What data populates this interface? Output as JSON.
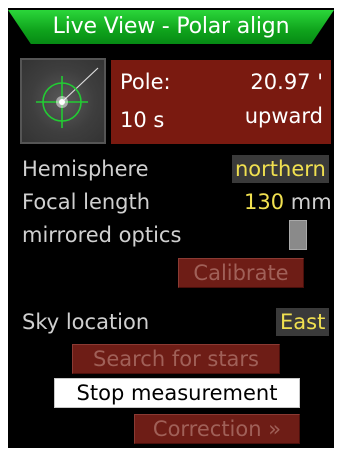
{
  "title": "Live View - Polar align",
  "status": {
    "pole_label": "Pole:",
    "pole_value": "20.97 '",
    "time_value": "10 s",
    "direction_value": "upward"
  },
  "settings": {
    "hemisphere_label": "Hemisphere",
    "hemisphere_value": "northern",
    "focal_label": "Focal length",
    "focal_value": "130",
    "focal_unit": "mm",
    "mirrored_label": "mirrored optics",
    "mirrored_checked": false,
    "sky_label": "Sky location",
    "sky_value": "East"
  },
  "buttons": {
    "calibrate": "Calibrate",
    "search": "Search for stars",
    "stop": "Stop measurement",
    "correction": "Correction »"
  },
  "colors": {
    "title_bar": "#0fa31c",
    "info_box": "#7a1a10",
    "value_text": "#f0e050",
    "disabled_button": "#6e1d16",
    "crosshair": "#22cc33"
  },
  "icons": {
    "thumbnail": "crosshair-star-icon"
  }
}
